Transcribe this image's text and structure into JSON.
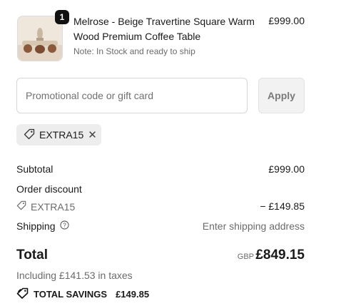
{
  "product": {
    "title": "Melrose - Beige Travertine Square Warm Wood Premium Coffee Table",
    "note": "Note: In Stock and ready to ship",
    "price": "£999.00",
    "quantity": "1",
    "image_icon": "coffee-table-thumbnail"
  },
  "promo": {
    "placeholder": "Promotional code or gift card",
    "value": "",
    "apply_label": "Apply",
    "applied_code": "EXTRA15"
  },
  "summary": {
    "subtotal_label": "Subtotal",
    "subtotal_value": "£999.00",
    "discount_label": "Order discount",
    "discount_code": "EXTRA15",
    "discount_value": "− £149.85",
    "shipping_label": "Shipping",
    "shipping_value": "Enter shipping address"
  },
  "total": {
    "label": "Total",
    "currency": "GBP",
    "value": "£849.15",
    "taxes": "Including £141.53 in taxes",
    "savings_label": "TOTAL SAVINGS",
    "savings_value": "£149.85"
  },
  "colors": {
    "text": "#1a1a1a",
    "muted": "#6b6b6b",
    "chip_bg": "#ededed",
    "button_bg": "#f2f2f2"
  }
}
